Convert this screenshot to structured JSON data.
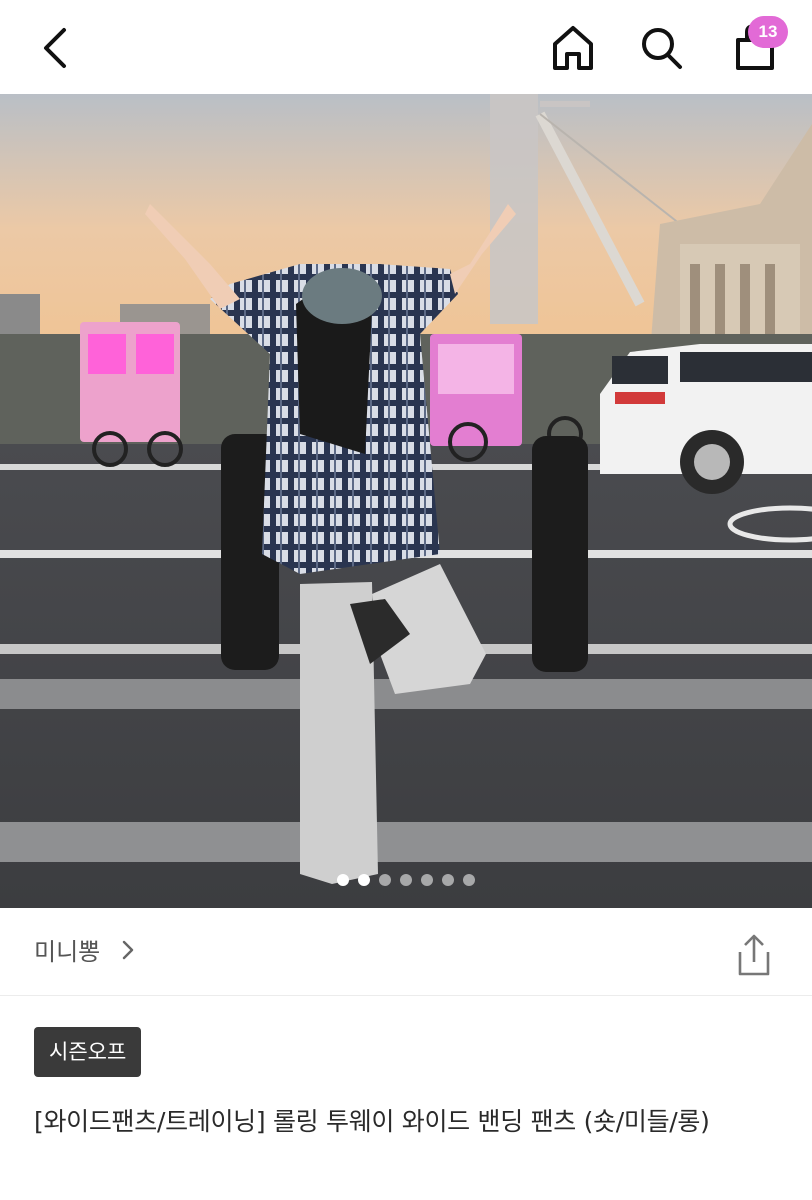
{
  "header": {
    "cart_count": "13",
    "icons": [
      "back-arrow-icon",
      "home-icon",
      "search-icon",
      "shopping-bag-icon"
    ]
  },
  "gallery": {
    "current_index": 1,
    "total": 7
  },
  "shop": {
    "name": "미니뽕"
  },
  "product": {
    "tag": "시즌오프",
    "title": "[와이드팬츠/트레이닝] 롤링 투웨이 와이드 밴딩 팬츠 (숏/미들/롱)"
  },
  "colors": {
    "badge": "#e26ad6",
    "tag_bg": "#3a3a3a"
  }
}
